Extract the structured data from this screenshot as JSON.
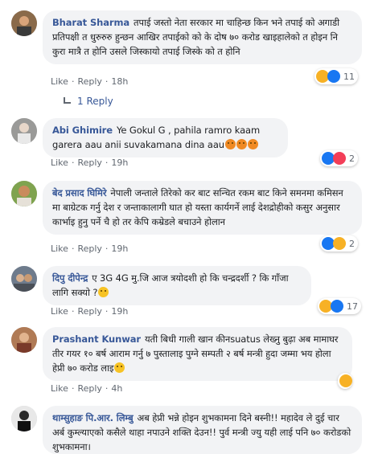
{
  "comments": [
    {
      "author": "Bharat Sharma",
      "text": "तपाई जस्तो नेता सरकार मा चाहिन्छ किन भने तपाई को अगाडी प्रतिपक्षी त धुरुरुरु हुन्छन आखिर तपाईको को के दोष ७० करोड खाइहालेको त होइन नि कुरा मात्रै त होनि उसले जिस्कायो तपाई जिस्के को त होनि",
      "actions": {
        "like": "Like",
        "reply": "Reply",
        "time": "18h"
      },
      "reactions": {
        "icons": [
          "haha-icon",
          "like-icon"
        ],
        "count": "11"
      }
    },
    {
      "author": "Abi Ghimire",
      "text": "Ye Gokul G , pahila ramro kaam garera aau anii suvakamana dina aau",
      "actions": {
        "like": "Like",
        "reply": "Reply",
        "time": "19h"
      },
      "reactions": {
        "icons": [
          "like-icon",
          "love-icon"
        ],
        "count": "2"
      }
    },
    {
      "author": "बेद प्रसाद घिमिरे",
      "text": "नेपाली जन्ताले तिरेको कर बाट सन्चित रकम बाट किने समनमा कमिसन मा बाग्रेटक गर्नु देश र जन्ताकालागी घात हो यस्ता कार्यगर्ने लाई देशद्रोहीको कसुर अनुसार कार्भाइ हुनु पर्ने चै हो तर केपि कम्रेडले बचाउने होलान",
      "actions": {
        "like": "Like",
        "reply": "Reply",
        "time": "19h"
      },
      "reactions": {
        "icons": [
          "like-icon",
          "sad-icon"
        ],
        "count": "2"
      }
    },
    {
      "author": "दिपु दीपेन्द्र",
      "text": "ए 3G 4G मु.जि आज त्रयोदशी हो कि चन्द्रदर्शी ? कि गाँजा लागि सक्यो ?",
      "actions": {
        "like": "Like",
        "reply": "Reply",
        "time": "19h"
      },
      "reactions": {
        "icons": [
          "haha-icon",
          "like-icon"
        ],
        "count": "17"
      }
    },
    {
      "author": "Prashant Kunwar",
      "text": "यती बिधी गाली खान कीनsuatus लेख्नु बुढ़ा अब मामाघर तीर गयर १० बर्ष आराम गर्नु ७ पुस्तालाइ पुग्ने सम्पती २ बर्ष मन्त्री हुदा जम्मा भय होला हेप्री ७० करोड लाइ",
      "actions": {
        "like": "Like",
        "reply": "Reply",
        "time": "4h"
      },
      "reactions": {
        "icons": [
          "haha-icon"
        ],
        "count": ""
      }
    },
    {
      "author": "थाम्सुहाङ पि.आर. लिम्बु",
      "text": "अब हेप्री भन्ने होइन शुभकामना दिने बस्नी!! महादेव ले दुई चार अर्ब कुम्ल्याएको कसैले थाहा नपाउने शक्ति देउन!! पुर्व मन्त्री ज्यु यही लाई पनि ७० करोडको शुभकामना।",
      "actions": {
        "like": "",
        "reply": "",
        "time": ""
      },
      "reactions": {
        "icons": [],
        "count": ""
      }
    }
  ],
  "reply_link": {
    "label": "1 Reply"
  },
  "colors": {
    "author": "#385898",
    "bubble": "#f2f3f5",
    "meta": "#606770"
  }
}
